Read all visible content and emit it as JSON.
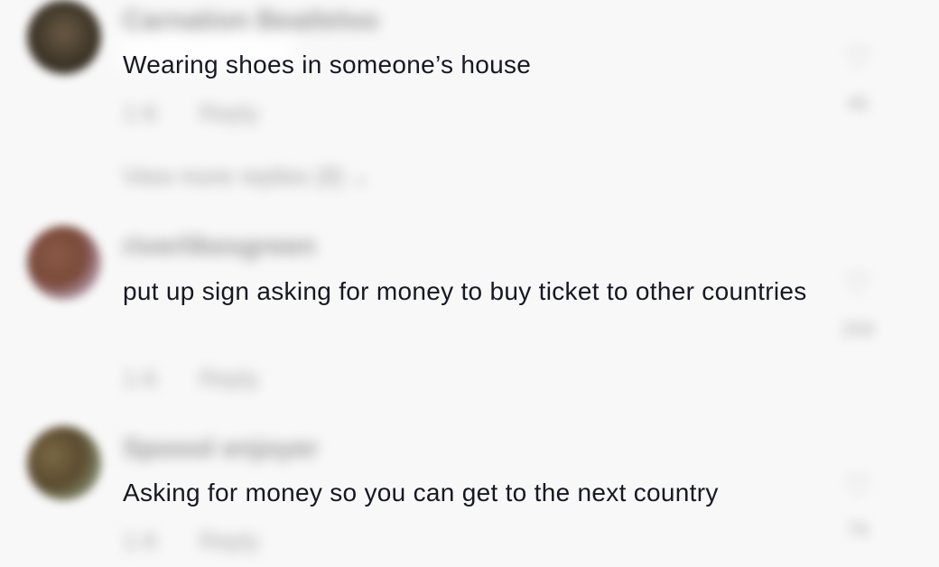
{
  "comments": [
    {
      "username": "Carnation Beatleloo",
      "text": "Wearing shoes in someone’s house",
      "time": "1-6",
      "reply_label": "Reply",
      "view_replies": "View more replies (8)",
      "likes": "46",
      "avatar_colors": [
        "#3b3326",
        "#6a5a45"
      ]
    },
    {
      "username": "riverlikesgreen",
      "text": "put up sign asking for money to buy ticket to other countries",
      "time": "1-6",
      "reply_label": "Reply",
      "likes": "268",
      "avatar_colors": [
        "#7a4a3a",
        "#c9b7d6"
      ]
    },
    {
      "username": "Spoool enjoyer",
      "text": "Asking for money so you can get to the next country",
      "time": "1-6",
      "reply_label": "Reply",
      "likes": "76",
      "avatar_colors": [
        "#5b4a2f",
        "#8a9a7a"
      ]
    }
  ],
  "icons": {
    "like": "heart-icon",
    "chevron": "chevron-down-icon"
  },
  "colors": {
    "background": "#f8f8f8",
    "text": "#161823",
    "muted": "#a8a8a8"
  }
}
